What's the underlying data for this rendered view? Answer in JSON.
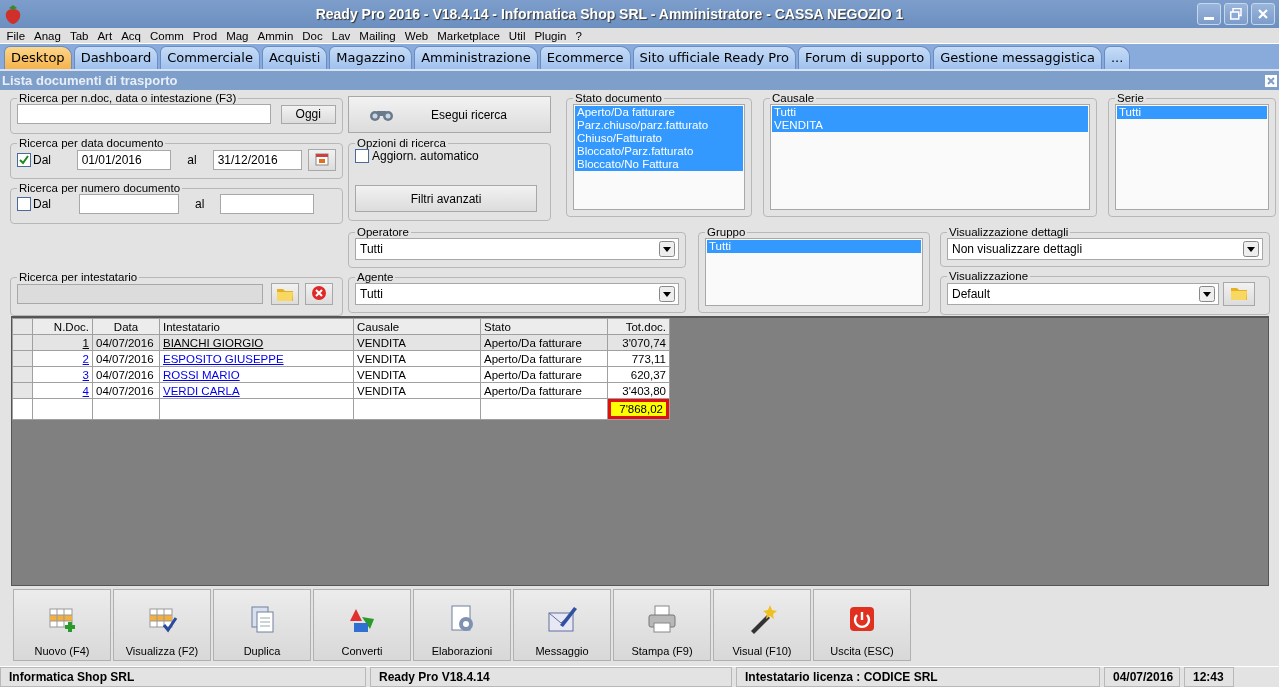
{
  "window": {
    "title": "Ready Pro 2016 - V18.4.14 - Informatica Shop SRL - Amministratore - CASSA NEGOZIO 1"
  },
  "menu": [
    "File",
    "Anag",
    "Tab",
    "Art",
    "Acq",
    "Comm",
    "Prod",
    "Mag",
    "Ammin",
    "Doc",
    "Lav",
    "Mailing",
    "Web",
    "Marketplace",
    "Util",
    "Plugin",
    "?"
  ],
  "tabs": [
    {
      "label": "Desktop",
      "selected": true
    },
    {
      "label": "Dashboard",
      "selected": false
    },
    {
      "label": "Commerciale",
      "selected": false
    },
    {
      "label": "Acquisti",
      "selected": false
    },
    {
      "label": "Magazzino",
      "selected": false
    },
    {
      "label": "Amministrazione",
      "selected": false
    },
    {
      "label": "Ecommerce",
      "selected": false
    },
    {
      "label": "Sito ufficiale Ready Pro",
      "selected": false
    },
    {
      "label": "Forum di supporto",
      "selected": false
    },
    {
      "label": "Gestione messaggistica",
      "selected": false
    },
    {
      "label": "...",
      "selected": false
    }
  ],
  "panel": {
    "title": "Lista documenti di trasporto"
  },
  "text_search": {
    "legend": "Ricerca per n.doc, data o intestazione (F3)",
    "button": "Oggi"
  },
  "date_search": {
    "legend": "Ricerca per data documento",
    "checked": true,
    "from_label": "Dal",
    "from": "01/01/2016",
    "to_label": "al",
    "to": "31/12/2016"
  },
  "number_search": {
    "legend": "Ricerca per numero documento",
    "checked": false,
    "from_label": "Dal",
    "to_label": "al"
  },
  "search_button": "Esegui ricerca",
  "search_options": {
    "legend": "Opzioni di ricerca",
    "auto_update": {
      "label": "Aggiorn. automatico",
      "checked": false
    },
    "advanced_button": "Filtri avanzati"
  },
  "lists": [
    {
      "legend": "Stato documento",
      "items": [
        {
          "label": "Aperto/Da fatturare",
          "selected": true
        },
        {
          "label": "Parz.chiuso/parz.fatturato",
          "selected": true
        },
        {
          "label": "Chiuso/Fatturato",
          "selected": true
        },
        {
          "label": "Bloccato/Parz.fatturato",
          "selected": true
        },
        {
          "label": "Bloccato/No Fattura",
          "selected": true
        }
      ]
    },
    {
      "legend": "Causale",
      "items": [
        {
          "label": "Tutti",
          "selected": true
        },
        {
          "label": "VENDITA",
          "selected": true
        }
      ]
    },
    {
      "legend": "Serie",
      "items": [
        {
          "label": "Tutti",
          "selected": true
        }
      ]
    }
  ],
  "holder_search": {
    "legend": "Ricerca per intestatario"
  },
  "operator": {
    "legend": "Operatore",
    "value": "Tutti"
  },
  "agent": {
    "legend": "Agente",
    "value": "Tutti"
  },
  "group": {
    "legend": "Gruppo",
    "items": [
      {
        "label": "Tutti",
        "selected": true
      }
    ]
  },
  "detail_view": {
    "legend": "Visualizzazione dettagli",
    "value": "Non visualizzare dettagli"
  },
  "view": {
    "legend": "Visualizzazione",
    "value": "Default"
  },
  "table": {
    "columns": [
      "N.Doc.",
      "Data",
      "Intestatario",
      "Causale",
      "Stato",
      "Tot.doc."
    ],
    "rows": [
      {
        "selected": true,
        "cells": [
          "1",
          "04/07/2016",
          "BIANCHI GIORGIO",
          "VENDITA",
          "Aperto/Da fatturare",
          "3'070,74"
        ]
      },
      {
        "selected": false,
        "cells": [
          "2",
          "04/07/2016",
          "ESPOSITO GIUSEPPE",
          "VENDITA",
          "Aperto/Da fatturare",
          "773,11"
        ]
      },
      {
        "selected": false,
        "cells": [
          "3",
          "04/07/2016",
          "ROSSI MARIO",
          "VENDITA",
          "Aperto/Da fatturare",
          "620,37"
        ]
      },
      {
        "selected": false,
        "cells": [
          "4",
          "04/07/2016",
          "VERDI CARLA",
          "VENDITA",
          "Aperto/Da fatturare",
          "3'403,80"
        ]
      }
    ],
    "total": "7'868,02"
  },
  "toolbar": [
    "Nuovo (F4)",
    "Visualizza (F2)",
    "Duplica",
    "Converti",
    "Elaborazioni",
    "Messaggio",
    "Stampa (F9)",
    "Visual (F10)",
    "Uscita (ESC)"
  ],
  "status_bar": [
    "Informatica Shop SRL",
    "Ready Pro V18.4.14",
    "Intestatario licenza : CODICE SRL",
    "04/07/2016",
    "12:43"
  ]
}
